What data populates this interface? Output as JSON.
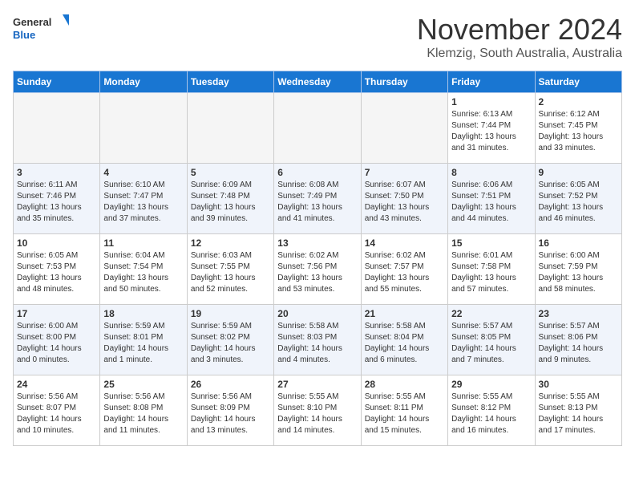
{
  "header": {
    "logo_general": "General",
    "logo_blue": "Blue",
    "month_year": "November 2024",
    "location": "Klemzig, South Australia, Australia"
  },
  "weekdays": [
    "Sunday",
    "Monday",
    "Tuesday",
    "Wednesday",
    "Thursday",
    "Friday",
    "Saturday"
  ],
  "weeks": [
    [
      {
        "day": "",
        "sunrise": "",
        "sunset": "",
        "daylight": "",
        "empty": true
      },
      {
        "day": "",
        "sunrise": "",
        "sunset": "",
        "daylight": "",
        "empty": true
      },
      {
        "day": "",
        "sunrise": "",
        "sunset": "",
        "daylight": "",
        "empty": true
      },
      {
        "day": "",
        "sunrise": "",
        "sunset": "",
        "daylight": "",
        "empty": true
      },
      {
        "day": "",
        "sunrise": "",
        "sunset": "",
        "daylight": "",
        "empty": true
      },
      {
        "day": "1",
        "sunrise": "Sunrise: 6:13 AM",
        "sunset": "Sunset: 7:44 PM",
        "daylight": "Daylight: 13 hours and 31 minutes.",
        "empty": false
      },
      {
        "day": "2",
        "sunrise": "Sunrise: 6:12 AM",
        "sunset": "Sunset: 7:45 PM",
        "daylight": "Daylight: 13 hours and 33 minutes.",
        "empty": false
      }
    ],
    [
      {
        "day": "3",
        "sunrise": "Sunrise: 6:11 AM",
        "sunset": "Sunset: 7:46 PM",
        "daylight": "Daylight: 13 hours and 35 minutes.",
        "empty": false
      },
      {
        "day": "4",
        "sunrise": "Sunrise: 6:10 AM",
        "sunset": "Sunset: 7:47 PM",
        "daylight": "Daylight: 13 hours and 37 minutes.",
        "empty": false
      },
      {
        "day": "5",
        "sunrise": "Sunrise: 6:09 AM",
        "sunset": "Sunset: 7:48 PM",
        "daylight": "Daylight: 13 hours and 39 minutes.",
        "empty": false
      },
      {
        "day": "6",
        "sunrise": "Sunrise: 6:08 AM",
        "sunset": "Sunset: 7:49 PM",
        "daylight": "Daylight: 13 hours and 41 minutes.",
        "empty": false
      },
      {
        "day": "7",
        "sunrise": "Sunrise: 6:07 AM",
        "sunset": "Sunset: 7:50 PM",
        "daylight": "Daylight: 13 hours and 43 minutes.",
        "empty": false
      },
      {
        "day": "8",
        "sunrise": "Sunrise: 6:06 AM",
        "sunset": "Sunset: 7:51 PM",
        "daylight": "Daylight: 13 hours and 44 minutes.",
        "empty": false
      },
      {
        "day": "9",
        "sunrise": "Sunrise: 6:05 AM",
        "sunset": "Sunset: 7:52 PM",
        "daylight": "Daylight: 13 hours and 46 minutes.",
        "empty": false
      }
    ],
    [
      {
        "day": "10",
        "sunrise": "Sunrise: 6:05 AM",
        "sunset": "Sunset: 7:53 PM",
        "daylight": "Daylight: 13 hours and 48 minutes.",
        "empty": false
      },
      {
        "day": "11",
        "sunrise": "Sunrise: 6:04 AM",
        "sunset": "Sunset: 7:54 PM",
        "daylight": "Daylight: 13 hours and 50 minutes.",
        "empty": false
      },
      {
        "day": "12",
        "sunrise": "Sunrise: 6:03 AM",
        "sunset": "Sunset: 7:55 PM",
        "daylight": "Daylight: 13 hours and 52 minutes.",
        "empty": false
      },
      {
        "day": "13",
        "sunrise": "Sunrise: 6:02 AM",
        "sunset": "Sunset: 7:56 PM",
        "daylight": "Daylight: 13 hours and 53 minutes.",
        "empty": false
      },
      {
        "day": "14",
        "sunrise": "Sunrise: 6:02 AM",
        "sunset": "Sunset: 7:57 PM",
        "daylight": "Daylight: 13 hours and 55 minutes.",
        "empty": false
      },
      {
        "day": "15",
        "sunrise": "Sunrise: 6:01 AM",
        "sunset": "Sunset: 7:58 PM",
        "daylight": "Daylight: 13 hours and 57 minutes.",
        "empty": false
      },
      {
        "day": "16",
        "sunrise": "Sunrise: 6:00 AM",
        "sunset": "Sunset: 7:59 PM",
        "daylight": "Daylight: 13 hours and 58 minutes.",
        "empty": false
      }
    ],
    [
      {
        "day": "17",
        "sunrise": "Sunrise: 6:00 AM",
        "sunset": "Sunset: 8:00 PM",
        "daylight": "Daylight: 14 hours and 0 minutes.",
        "empty": false
      },
      {
        "day": "18",
        "sunrise": "Sunrise: 5:59 AM",
        "sunset": "Sunset: 8:01 PM",
        "daylight": "Daylight: 14 hours and 1 minute.",
        "empty": false
      },
      {
        "day": "19",
        "sunrise": "Sunrise: 5:59 AM",
        "sunset": "Sunset: 8:02 PM",
        "daylight": "Daylight: 14 hours and 3 minutes.",
        "empty": false
      },
      {
        "day": "20",
        "sunrise": "Sunrise: 5:58 AM",
        "sunset": "Sunset: 8:03 PM",
        "daylight": "Daylight: 14 hours and 4 minutes.",
        "empty": false
      },
      {
        "day": "21",
        "sunrise": "Sunrise: 5:58 AM",
        "sunset": "Sunset: 8:04 PM",
        "daylight": "Daylight: 14 hours and 6 minutes.",
        "empty": false
      },
      {
        "day": "22",
        "sunrise": "Sunrise: 5:57 AM",
        "sunset": "Sunset: 8:05 PM",
        "daylight": "Daylight: 14 hours and 7 minutes.",
        "empty": false
      },
      {
        "day": "23",
        "sunrise": "Sunrise: 5:57 AM",
        "sunset": "Sunset: 8:06 PM",
        "daylight": "Daylight: 14 hours and 9 minutes.",
        "empty": false
      }
    ],
    [
      {
        "day": "24",
        "sunrise": "Sunrise: 5:56 AM",
        "sunset": "Sunset: 8:07 PM",
        "daylight": "Daylight: 14 hours and 10 minutes.",
        "empty": false
      },
      {
        "day": "25",
        "sunrise": "Sunrise: 5:56 AM",
        "sunset": "Sunset: 8:08 PM",
        "daylight": "Daylight: 14 hours and 11 minutes.",
        "empty": false
      },
      {
        "day": "26",
        "sunrise": "Sunrise: 5:56 AM",
        "sunset": "Sunset: 8:09 PM",
        "daylight": "Daylight: 14 hours and 13 minutes.",
        "empty": false
      },
      {
        "day": "27",
        "sunrise": "Sunrise: 5:55 AM",
        "sunset": "Sunset: 8:10 PM",
        "daylight": "Daylight: 14 hours and 14 minutes.",
        "empty": false
      },
      {
        "day": "28",
        "sunrise": "Sunrise: 5:55 AM",
        "sunset": "Sunset: 8:11 PM",
        "daylight": "Daylight: 14 hours and 15 minutes.",
        "empty": false
      },
      {
        "day": "29",
        "sunrise": "Sunrise: 5:55 AM",
        "sunset": "Sunset: 8:12 PM",
        "daylight": "Daylight: 14 hours and 16 minutes.",
        "empty": false
      },
      {
        "day": "30",
        "sunrise": "Sunrise: 5:55 AM",
        "sunset": "Sunset: 8:13 PM",
        "daylight": "Daylight: 14 hours and 17 minutes.",
        "empty": false
      }
    ]
  ]
}
